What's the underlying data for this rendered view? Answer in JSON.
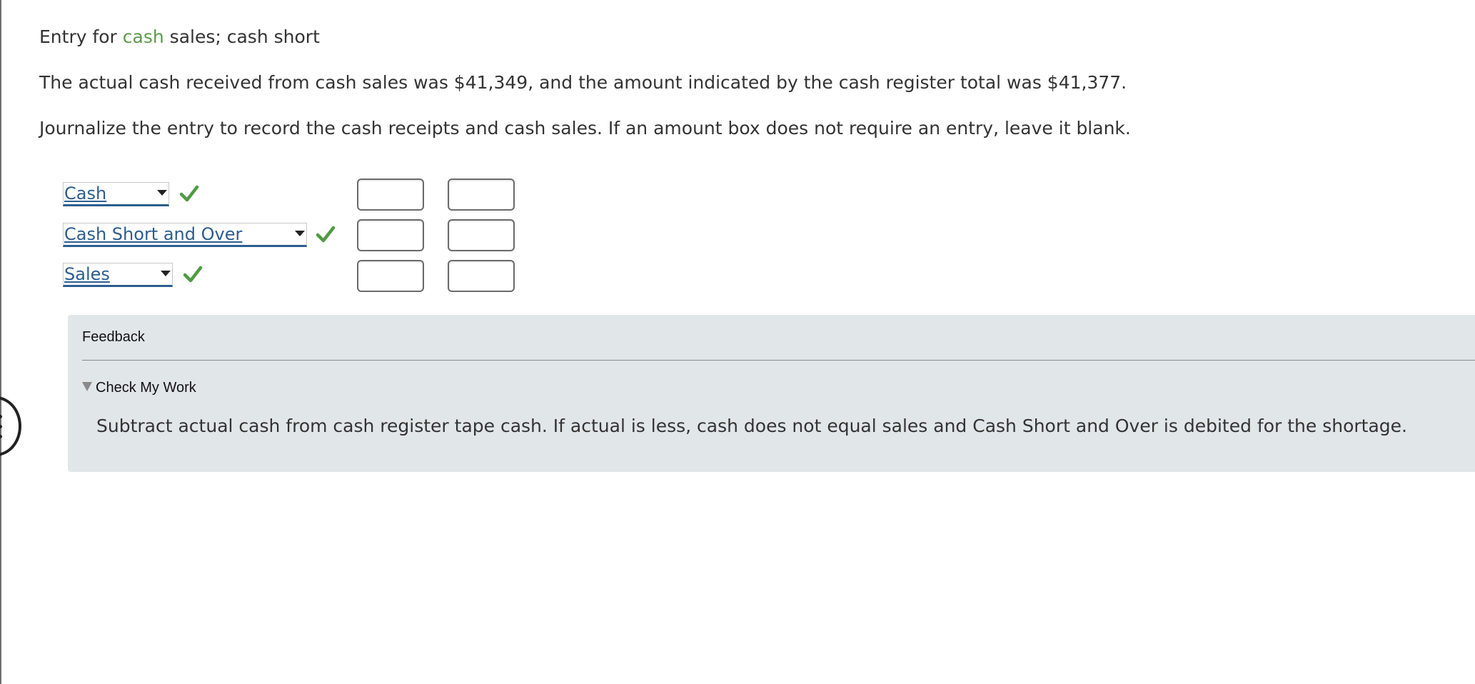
{
  "problem": {
    "title_prefix": "Entry for ",
    "title_highlight": "cash",
    "title_suffix": " sales; cash short",
    "paragraph_1": "The actual cash received from cash sales was $41,349, and the amount indicated by the cash register total was $41,377.",
    "paragraph_2": "Journalize the entry to record the cash receipts and cash sales. If an amount box does not require an entry, leave it blank."
  },
  "journal": {
    "rows": [
      {
        "account": "Cash",
        "status": "correct",
        "debit": "",
        "credit": ""
      },
      {
        "account": "Cash Short and Over",
        "status": "correct",
        "debit": "",
        "credit": ""
      },
      {
        "account": "Sales",
        "status": "correct",
        "debit": "",
        "credit": ""
      }
    ]
  },
  "feedback": {
    "heading": "Feedback",
    "toggle_label": "Check My Work",
    "toggle_state": "expanded",
    "text": "Subtract actual cash from cash register tape cash. If actual is less, cash does not equal sales and Cash Short and Over is debited for the shortage."
  },
  "colors": {
    "highlight_green": "#5e9a4c",
    "check_green": "#4f9a43",
    "account_blue": "#2c5d8f",
    "feedback_bg": "#e1e6e9"
  },
  "icons": {
    "dropdown": "chevron-down-icon",
    "status_correct": "checkmark-icon",
    "disclosure": "triangle-down-icon"
  }
}
